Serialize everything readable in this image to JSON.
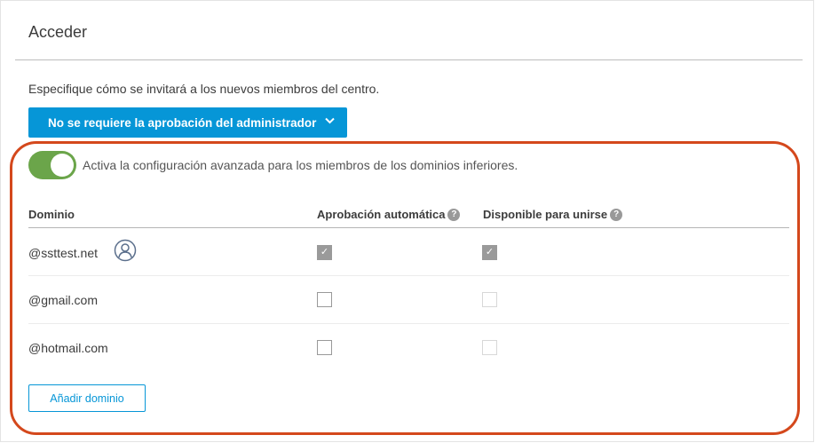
{
  "title": "Acceder",
  "description": "Especifique cómo se invitará a los nuevos miembros del centro.",
  "approval_dropdown": {
    "selected": "No se requiere la aprobación del administrador"
  },
  "advanced_toggle": {
    "on": true,
    "label": "Activa la configuración avanzada para los miembros de los dominios inferiores."
  },
  "table": {
    "headers": [
      "Dominio",
      "Aprobación automática",
      "Disponible para unirse"
    ],
    "rows": [
      {
        "domain": "@ssttest.net",
        "icon": "user-icon",
        "auto_approval": true,
        "available": true,
        "available_disabled": false
      },
      {
        "domain": "@gmail.com",
        "auto_approval": false,
        "available": false,
        "available_disabled": true
      },
      {
        "domain": "@hotmail.com",
        "auto_approval": false,
        "available": false,
        "available_disabled": true
      }
    ]
  },
  "add_domain_label": "Añadir dominio",
  "colors": {
    "accent": "#0696d7",
    "toggle": "#6ba54a",
    "highlight": "#d4481c"
  }
}
